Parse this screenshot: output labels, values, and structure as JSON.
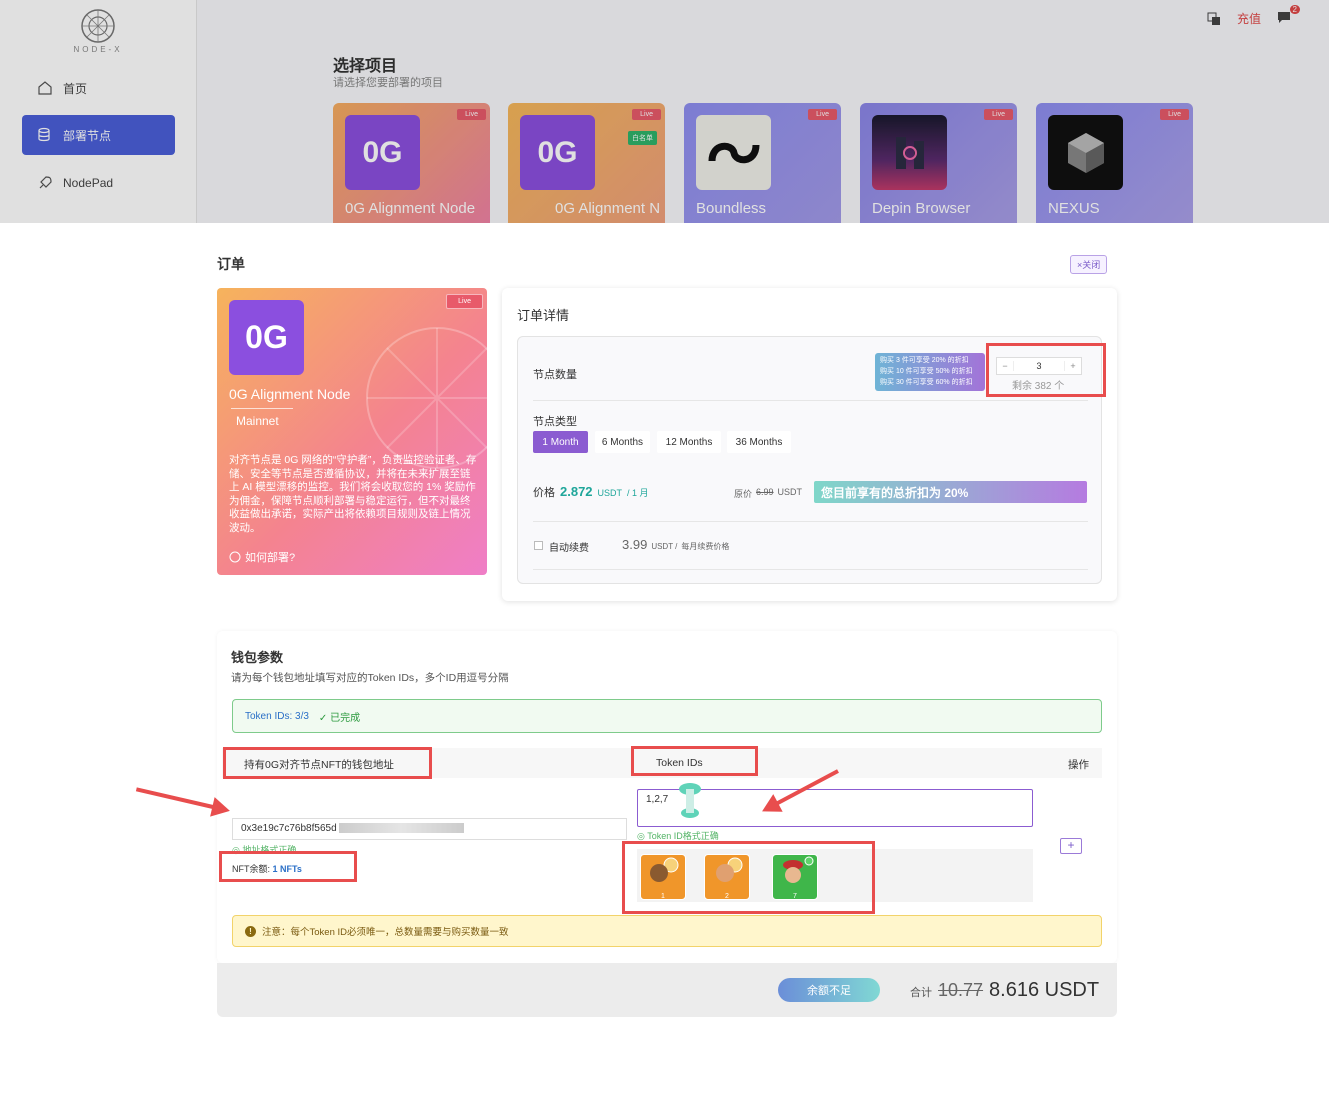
{
  "brand": {
    "name": "NODE-X"
  },
  "topbar": {
    "recharge": "充值",
    "notify_count": "2"
  },
  "sidebar": {
    "items": [
      {
        "label": "首页"
      },
      {
        "label": "部署节点"
      },
      {
        "label": "NodePad"
      }
    ]
  },
  "select": {
    "title": "选择项目",
    "subtitle": "请选择您要部署的项目",
    "projects": [
      {
        "name": "0G Alignment Node",
        "badge": "Live",
        "logo": "0G"
      },
      {
        "name": "0G Alignment N",
        "badge": "Live",
        "logo": "0G",
        "tag": "白名单"
      },
      {
        "name": "Boundless",
        "badge": "Live"
      },
      {
        "name": "Depin Browser",
        "badge": "Live"
      },
      {
        "name": "NEXUS",
        "badge": "Live"
      }
    ]
  },
  "order": {
    "title": "订单",
    "close_label": "×关闭",
    "card": {
      "logo": "0G",
      "badge": "Live",
      "name": "0G Alignment Node",
      "network": "Mainnet",
      "description": "对齐节点是 0G 网络的“守护者”，负责监控验证者、存储、安全等节点是否遵循协议，并将在未来扩展至链上 AI 模型漂移的监控。我们将会收取您的 1% 奖励作为佣金，保障节点顺利部署与稳定运行，但不对最终收益做出承诺，实际产出将依赖项目规则及链上情况波动。",
      "how_to": "如何部署?"
    },
    "details": {
      "title": "订单详情",
      "qty_label": "节点数量",
      "discounts": [
        "购买 3 件可享受 20% 的折扣",
        "购买 10 件可享受 50% 的折扣",
        "购买 30 件可享受 60% 的折扣"
      ],
      "qty_minus": "−",
      "qty_value": "3",
      "qty_plus": "+",
      "remaining": "剩余 382 个",
      "type_label": "节点类型",
      "types": [
        "1 Month",
        "6 Months",
        "12 Months",
        "36 Months"
      ],
      "price_label": "价格",
      "price": "2.872",
      "price_unit": "USDT",
      "price_period": "/ 1 月",
      "orig_label": "原价",
      "orig_price": "6.99",
      "orig_unit": "USDT",
      "discount_banner": "您目前享有的总折扣为 20%",
      "auto_label": "自动续费",
      "renew_price": "3.99",
      "renew_unit": "USDT /",
      "renew_desc": "每月续费价格"
    }
  },
  "wallet": {
    "title": "钱包参数",
    "subtitle": "请为每个钱包地址填写对应的Token IDs，多个ID用逗号分隔",
    "status_ids": "Token IDs: 3/3",
    "status_done": "✓ 已完成",
    "col_address": "持有0G对齐节点NFT的钱包地址",
    "col_tokens": "Token IDs",
    "col_action": "操作",
    "address": "0x3e19c7c76b8f565d",
    "address_ok": "地址格式正确",
    "nft_balance_label": "NFT余额:",
    "nft_balance": "1 NFTs",
    "token_input": "1,2,7",
    "token_ok": "Token ID格式正确",
    "nfts": [
      {
        "id": "1",
        "color": "#f0962a"
      },
      {
        "id": "2",
        "color": "#f0962a"
      },
      {
        "id": "7",
        "color": "#3fb64a"
      }
    ],
    "add_label": "+",
    "notice": "注意：每个Token ID必须唯一，总数量需要与购买数量一致"
  },
  "footer": {
    "button": "余额不足",
    "total_label": "合计",
    "total_original": "10.77",
    "total": "8.616 USDT"
  }
}
